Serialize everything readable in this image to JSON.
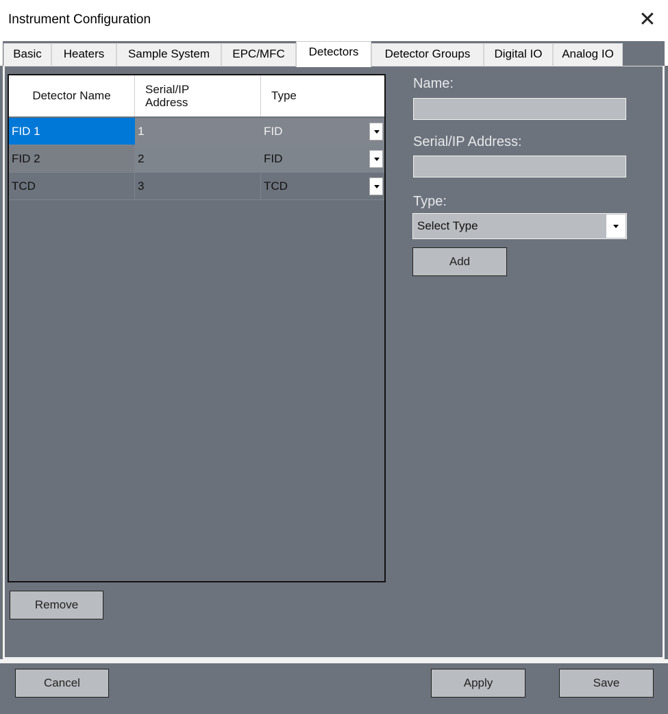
{
  "window": {
    "title": "Instrument Configuration",
    "close_glyph": "✕"
  },
  "tabs": [
    {
      "label": "Basic"
    },
    {
      "label": "Heaters"
    },
    {
      "label": "Sample System"
    },
    {
      "label": "EPC/MFC"
    },
    {
      "label": "Detectors",
      "active": true
    },
    {
      "label": "Detector Groups"
    },
    {
      "label": "Digital IO"
    },
    {
      "label": "Analog IO"
    }
  ],
  "grid": {
    "columns": [
      "Detector Name",
      "Serial/IP Address",
      "Type"
    ],
    "col_header_lines": {
      "serial_line1": "Serial/IP",
      "serial_line2": "Address"
    },
    "rows": [
      {
        "name": "FID 1",
        "address": "1",
        "type": "FID",
        "selected": true
      },
      {
        "name": "FID 2",
        "address": "2",
        "type": "FID"
      },
      {
        "name": "TCD",
        "address": "3",
        "type": "TCD"
      }
    ]
  },
  "form": {
    "name_label": "Name:",
    "name_value": "",
    "address_label": "Serial/IP Address:",
    "address_value": "",
    "type_label": "Type:",
    "type_selected": "Select Type",
    "add_label": "Add"
  },
  "actions": {
    "remove_label": "Remove",
    "cancel_label": "Cancel",
    "apply_label": "Apply",
    "save_label": "Save"
  },
  "colors": {
    "background": "#6d737d",
    "selection": "#0078d7",
    "field": "#b9bcc0"
  }
}
